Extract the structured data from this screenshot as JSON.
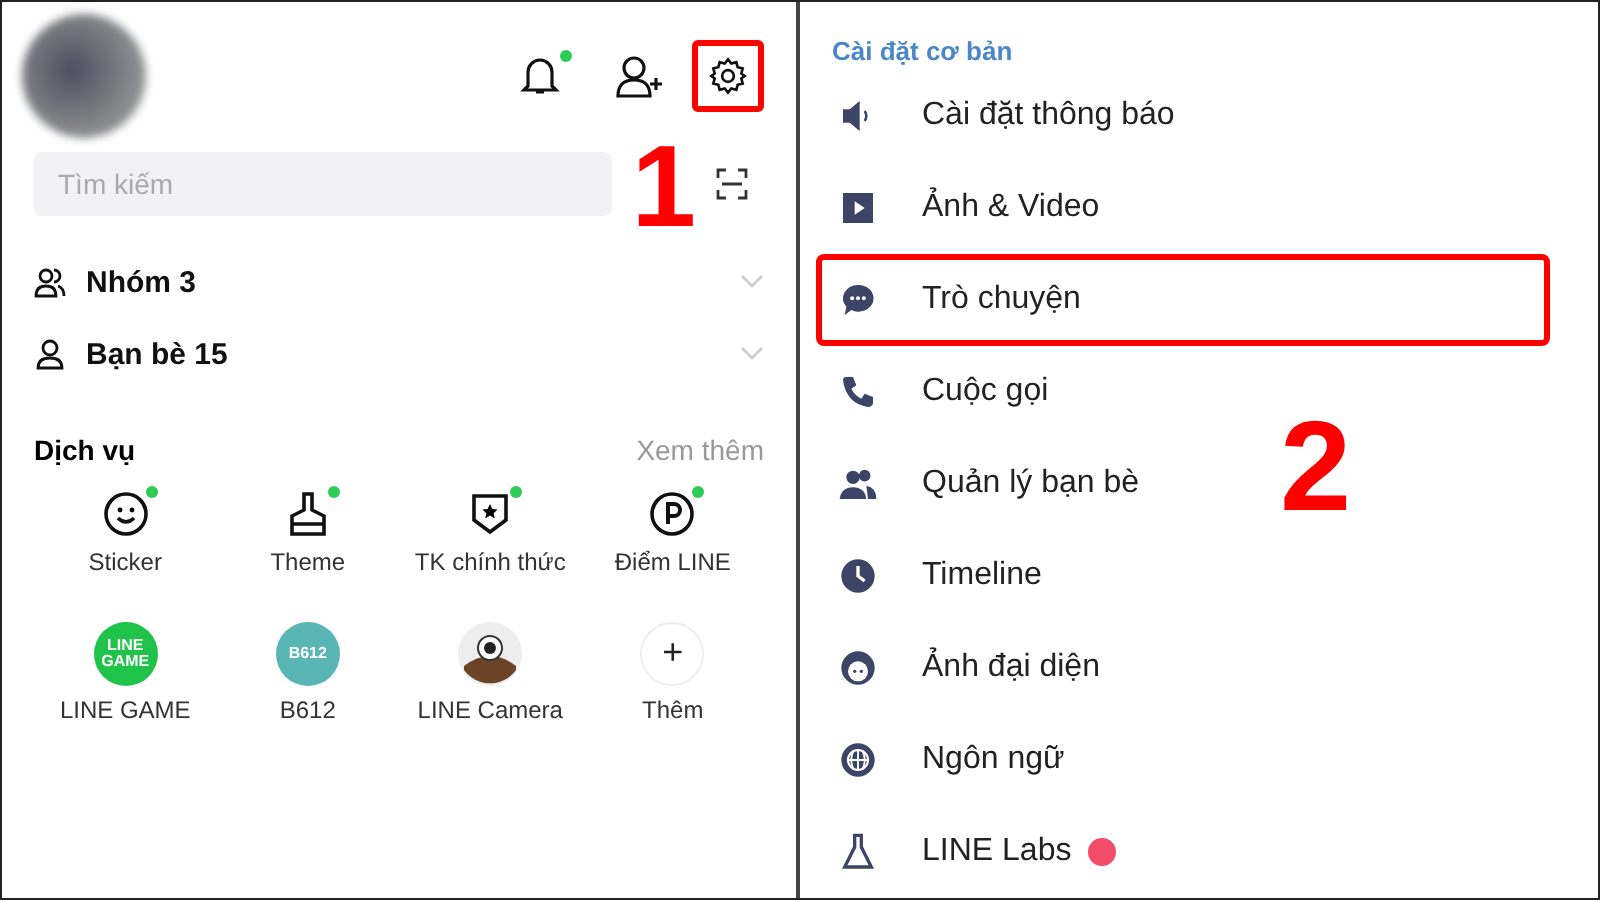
{
  "left_screen": {
    "header": {
      "notification_badge": true,
      "settings_highlighted": true,
      "step_number": "1"
    },
    "search": {
      "placeholder": "Tìm kiếm"
    },
    "groups": [
      {
        "label": "Nhóm 3"
      },
      {
        "label": "Bạn bè 15"
      }
    ],
    "services": {
      "title": "Dịch vụ",
      "more": "Xem thêm",
      "items": [
        {
          "label": "Sticker",
          "badge": true
        },
        {
          "label": "Theme",
          "badge": true
        },
        {
          "label": "TK chính thức",
          "badge": true
        },
        {
          "label": "Điểm LINE",
          "badge": true
        },
        {
          "label": "LINE GAME",
          "logo_text": "LINE GAME"
        },
        {
          "label": "B612",
          "logo_text": "B612"
        },
        {
          "label": "LINE Camera"
        },
        {
          "label": "Thêm",
          "symbol": "+"
        }
      ]
    }
  },
  "right_screen": {
    "section_title": "Cài đặt cơ bản",
    "step_number": "2",
    "items": [
      {
        "label": "Cài đặt thông báo",
        "highlighted": false,
        "badge": false
      },
      {
        "label": "Ảnh & Video",
        "highlighted": false,
        "badge": false
      },
      {
        "label": "Trò chuyện",
        "highlighted": true,
        "badge": false
      },
      {
        "label": "Cuộc gọi",
        "highlighted": false,
        "badge": false
      },
      {
        "label": "Quản lý bạn bè",
        "highlighted": false,
        "badge": false
      },
      {
        "label": "Timeline",
        "highlighted": false,
        "badge": false
      },
      {
        "label": "Ảnh đại diện",
        "highlighted": false,
        "badge": false
      },
      {
        "label": "Ngôn ngữ",
        "highlighted": false,
        "badge": false
      },
      {
        "label": "LINE Labs",
        "highlighted": false,
        "badge": true
      }
    ]
  }
}
